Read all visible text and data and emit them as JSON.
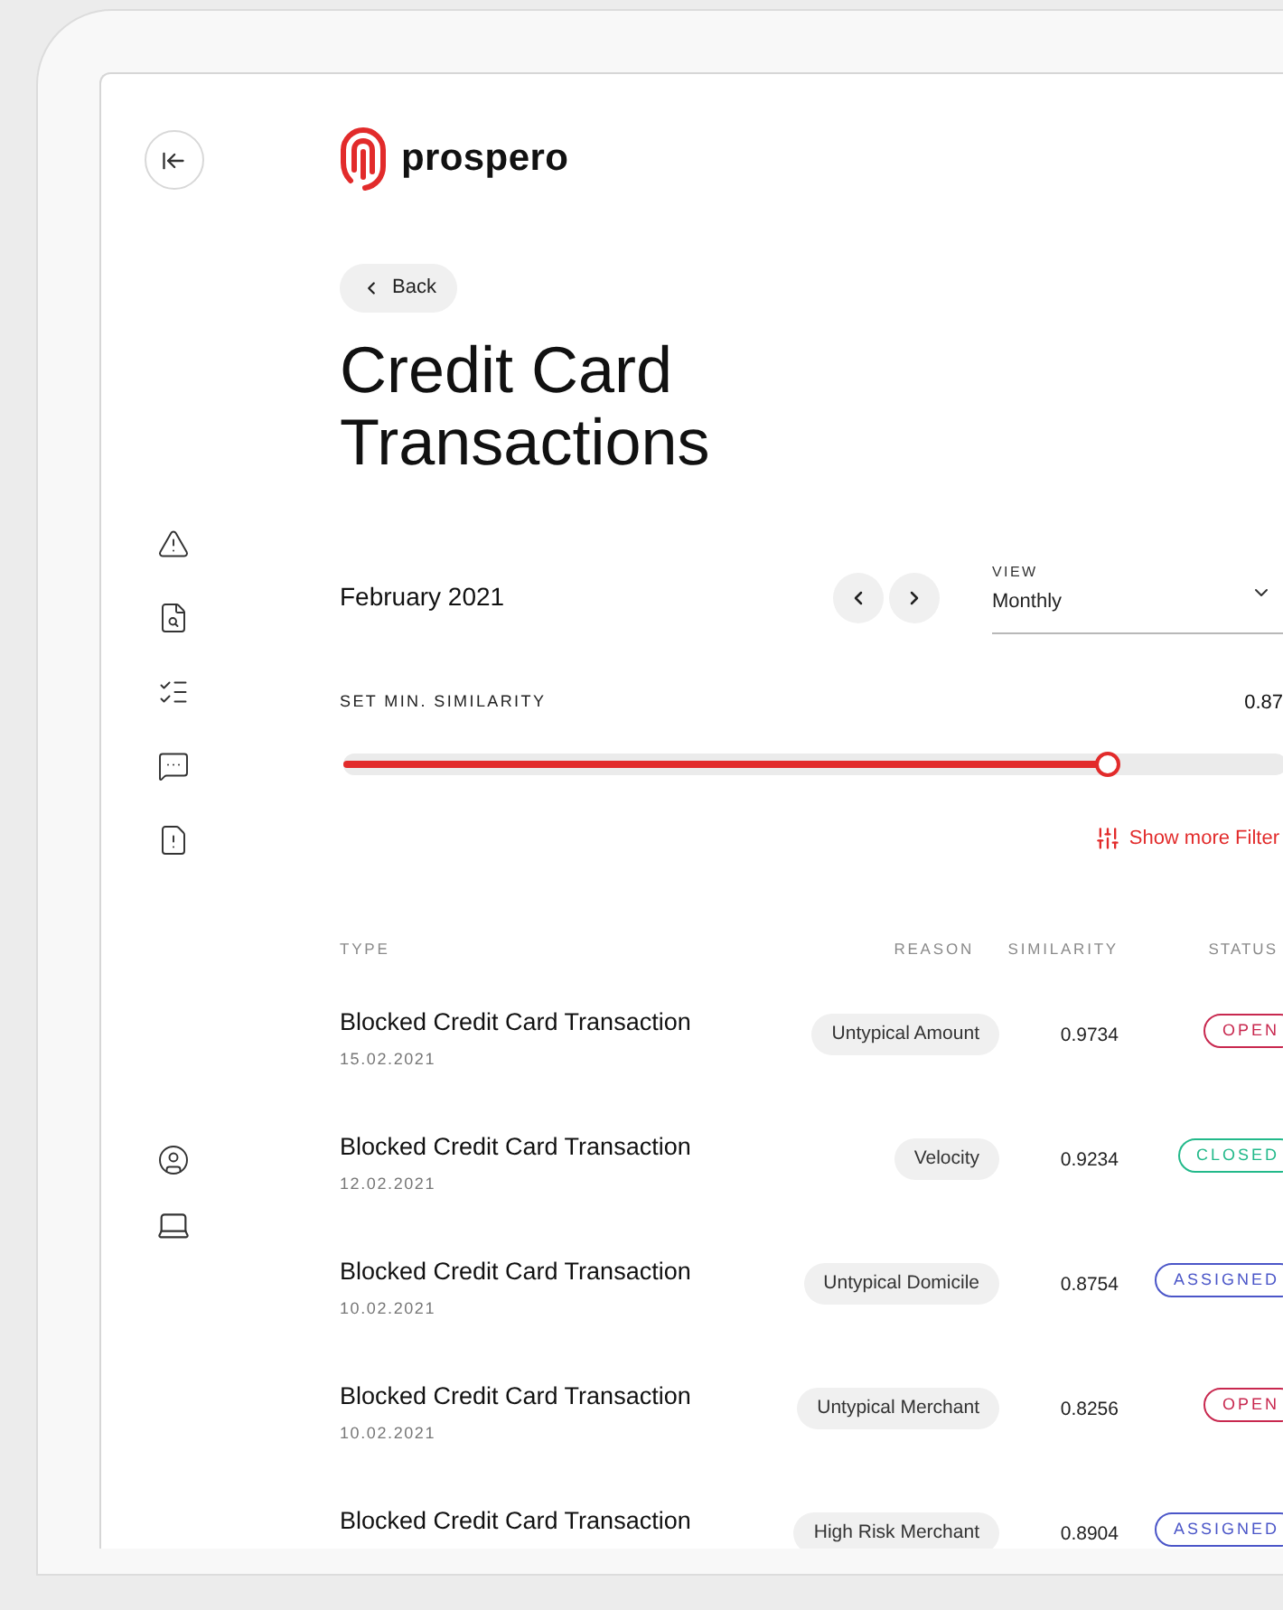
{
  "brand": "prospero",
  "back": "Back",
  "title": "Credit Card Transactions",
  "period": {
    "label": "February 2021",
    "view_label": "VIEW",
    "view_value": "Monthly"
  },
  "similarity_filter": {
    "label": "SET MIN. SIMILARITY",
    "reading": "0.87",
    "level": 0.81
  },
  "more_filters": "Show more Filter",
  "table": {
    "columns": [
      "TYPE",
      "REASON",
      "SIMILARITY",
      "STATUS"
    ],
    "rows": [
      {
        "type": "Blocked Credit Card Transaction",
        "date": "15.02.2021",
        "reason": "Untypical Amount",
        "similarity": "0.9734",
        "status": "OPEN",
        "color": "#c8284f"
      },
      {
        "type": "Blocked Credit Card Transaction",
        "date": "12.02.2021",
        "reason": "Velocity",
        "similarity": "0.9234",
        "status": "CLOSED",
        "color": "#22b98a"
      },
      {
        "type": "Blocked Credit Card Transaction",
        "date": "10.02.2021",
        "reason": "Untypical Domicile",
        "similarity": "0.8754",
        "status": "ASSIGNED",
        "color": "#4b56c8"
      },
      {
        "type": "Blocked Credit Card Transaction",
        "date": "10.02.2021",
        "reason": "Untypical Merchant",
        "similarity": "0.8256",
        "status": "OPEN",
        "color": "#c8284f"
      },
      {
        "type": "Blocked Credit Card Transaction",
        "reason": "High Risk Merchant",
        "similarity": "0.8904",
        "status": "ASSIGNED",
        "color": "#4b56c8"
      }
    ]
  }
}
